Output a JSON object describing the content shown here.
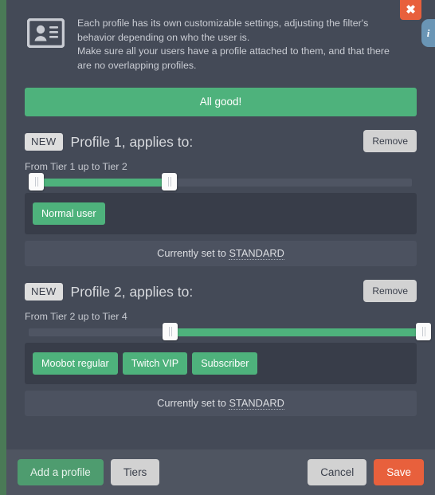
{
  "window": {
    "close_label": "✖",
    "info_label": "i",
    "accent_green": "#4eb27c",
    "accent_orange": "#e8603c",
    "panel_bg": "#444a57",
    "page_bg": "#4a7a56"
  },
  "intro": {
    "icon": "contact-card-icon",
    "line1": "Each profile has its own customizable settings, adjusting the filter's behavior depending on who the user is.",
    "line2": "Make sure all your users have a profile attached to them, and that there are no overlapping profiles."
  },
  "status": {
    "text": "All good!"
  },
  "profiles": [
    {
      "badge": "NEW",
      "title": "Profile 1, applies to:",
      "remove_label": "Remove",
      "tier_label": "From Tier 1 up to Tier 2",
      "slider": {
        "min_tier": 1,
        "max_tier": 2,
        "range_min": 1,
        "range_max": 7,
        "left_pct": 0,
        "right_pct": 33
      },
      "tags": [
        "Normal user"
      ],
      "current_prefix": "Currently set to ",
      "current_value": "STANDARD"
    },
    {
      "badge": "NEW",
      "title": "Profile 2, applies to:",
      "remove_label": "Remove",
      "tier_label": "From Tier 2 up to Tier 4",
      "slider": {
        "min_tier": 2,
        "max_tier": 4,
        "range_min": 1,
        "range_max": 7,
        "left_pct": 34,
        "right_pct": 100
      },
      "tags": [
        "Moobot regular",
        "Twitch VIP",
        "Subscriber"
      ],
      "current_prefix": "Currently set to ",
      "current_value": "STANDARD"
    }
  ],
  "footer": {
    "add_profile_label": "Add a profile",
    "tiers_label": "Tiers",
    "cancel_label": "Cancel",
    "save_label": "Save"
  }
}
